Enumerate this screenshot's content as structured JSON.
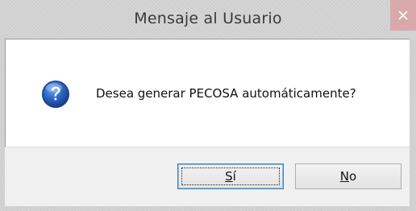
{
  "window": {
    "title": "Mensaje al Usuario",
    "close_glyph": "✕",
    "close_color": "#d9a9a9"
  },
  "message": {
    "icon": "question-icon",
    "text": "Desea generar PECOSA automáticamente?"
  },
  "buttons": {
    "yes": {
      "mnemonic": "S",
      "rest": "í",
      "default": true
    },
    "no": {
      "mnemonic": "N",
      "rest": "o",
      "default": false
    }
  }
}
